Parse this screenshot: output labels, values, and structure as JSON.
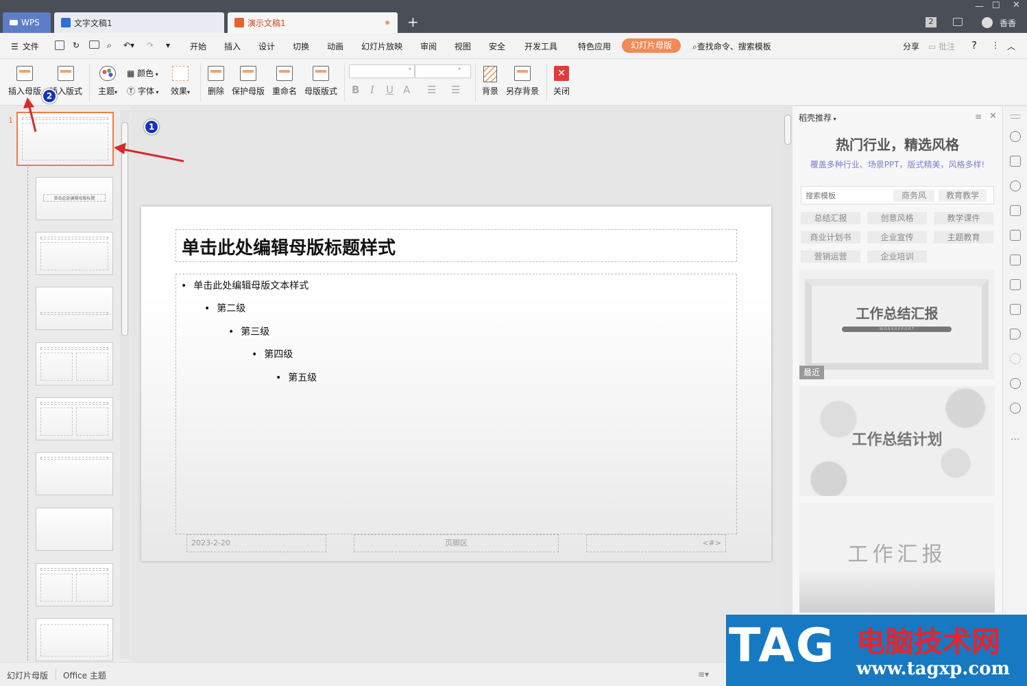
{
  "titlebar": {
    "tabs": [
      {
        "label": "WPS"
      },
      {
        "label": "文字文稿1"
      },
      {
        "label": "演示文稿1"
      }
    ],
    "new_tab": "+",
    "page_count": "2",
    "user": "香香"
  },
  "menubar": {
    "file": "文件",
    "items": [
      "开始",
      "插入",
      "设计",
      "切换",
      "动画",
      "幻灯片放映",
      "审阅",
      "视图",
      "安全",
      "开发工具",
      "特色应用"
    ],
    "active": "幻灯片母版",
    "search": "查找命令、搜索模板",
    "share": "分享",
    "comment": "批注"
  },
  "ribbon": {
    "insert_master": "插入母版",
    "insert_layout": "插入版式",
    "theme": "主题",
    "color": "颜色",
    "font": "字体",
    "effect": "效果",
    "delete": "删除",
    "protect_master": "保护母版",
    "rename": "重命名",
    "master_layout": "母版版式",
    "background": "背景",
    "save_background": "另存背景",
    "close": "关闭",
    "format_buttons": [
      "B",
      "I",
      "U",
      "A"
    ]
  },
  "thumbnails": {
    "first_number": "1",
    "layout_title_text": "单击此处编辑母版标题"
  },
  "slide": {
    "title": "单击此处编辑母版标题样式",
    "levels": [
      "单击此处编辑母版文本样式",
      "第二级",
      "第三级",
      "第四级",
      "第五级"
    ],
    "footer_date": "2023-2-20",
    "footer_text": "页脚区",
    "footer_num": "<#>"
  },
  "annotations": {
    "badge1": "1",
    "badge2": "2"
  },
  "right_panel": {
    "header": "稻壳推荐",
    "title": "热门行业，精选风格",
    "subtitle": "覆盖多种行业、场景PPT，版式精美，风格多样!",
    "search_placeholder": "搜索模板",
    "search_tags": [
      "商务风",
      "教育教学"
    ],
    "categories": [
      "总结汇报",
      "创意风格",
      "教学课件",
      "商业计划书",
      "企业宣传",
      "主题教育",
      "营销运营",
      "企业培训"
    ],
    "cards": [
      {
        "title": "工作总结汇报",
        "sub": "W O R K   R E P O R T",
        "badge": "最近"
      },
      {
        "title": "工作总结计划"
      },
      {
        "title": "工作汇报"
      }
    ]
  },
  "statusbar": {
    "left": "幻灯片母版",
    "theme": "Office 主题"
  },
  "watermark": {
    "tag": "TAG",
    "cn": "电脑技术网",
    "url": "www.tagxp.com"
  },
  "colors": {
    "accent": "#f28a58",
    "titlebar": "#4a4e57",
    "selected_border": "#f07b46",
    "watermark_bg": "#1679c2",
    "badge": "#1434b8"
  }
}
